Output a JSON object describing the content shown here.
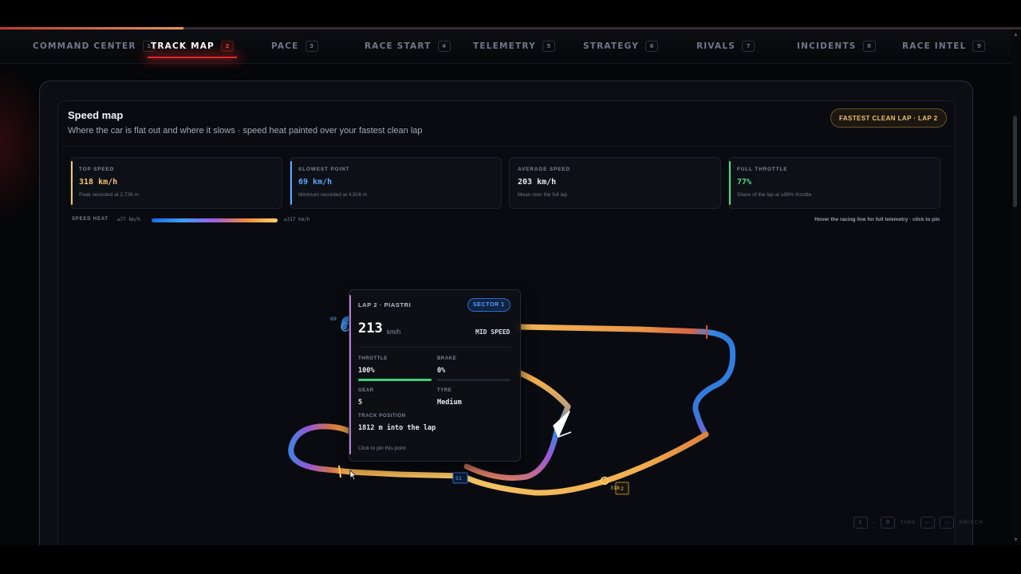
{
  "header": {
    "progress_fraction": 0.18,
    "tabs": [
      {
        "label": "COMMAND CENTER",
        "num": "1"
      },
      {
        "label": "TRACK MAP",
        "num": "2"
      },
      {
        "label": "PACE",
        "num": "3"
      },
      {
        "label": "RACE START",
        "num": "4"
      },
      {
        "label": "TELEMETRY",
        "num": "5"
      },
      {
        "label": "STRATEGY",
        "num": "6"
      },
      {
        "label": "RIVALS",
        "num": "7"
      },
      {
        "label": "INCIDENTS",
        "num": "8"
      },
      {
        "label": "RACE INTEL",
        "num": "9"
      }
    ],
    "active_tab": "TRACK MAP"
  },
  "card": {
    "title": "Speed map",
    "subtitle": "Where the car is flat out and where it slows · speed heat painted over your fastest clean lap",
    "lap_pill": "FASTEST CLEAN LAP · LAP 2"
  },
  "stats": [
    {
      "label": "TOP SPEED",
      "value": "318 km/h",
      "note": "Peak recorded at 2,738 m",
      "color": "#f3c76b"
    },
    {
      "label": "SLOWEST POINT",
      "value": "69 km/h",
      "note": "Minimum recorded at 4,926 m",
      "color": "#5aa8ff"
    },
    {
      "label": "AVERAGE SPEED",
      "value": "203 km/h",
      "note": "Mean over the full lap",
      "color": "#e8eaef"
    },
    {
      "label": "FULL THROTTLE",
      "value": "77%",
      "note": "Share of the lap at ≥98% throttle",
      "color": "#4fdc8a"
    }
  ],
  "heat": {
    "label": "SPEED HEAT",
    "min": "≤77 km/h",
    "max": "≥317 km/h",
    "hint": "Hover the racing line for full telemetry · click to pin"
  },
  "map_labels": {
    "slow_marker": "69",
    "fast_marker": "318",
    "sector_tag": "S1",
    "turn_tag": "2"
  },
  "tooltip": {
    "lap": "LAP 2 · PIASTRI",
    "sector": "SECTOR 1",
    "speed": "213",
    "unit": "km/h",
    "band": "MID SPEED",
    "throttle_label": "THROTTLE",
    "throttle": "100%",
    "throttle_fraction": 1.0,
    "brake_label": "BRAKE",
    "brake": "0%",
    "brake_fraction": 0.0,
    "gear_label": "GEAR",
    "gear": "5",
    "tyre_label": "TYRE",
    "tyre": "Medium",
    "position_label": "TRACK POSITION",
    "position": "1812 m into the lap",
    "click_hint": "Click to pin this point"
  },
  "footer": {
    "first_tab": "1",
    "separator": "–",
    "last_tab": "9",
    "tabs_label": "TABS",
    "prev_key": "←",
    "next_key": "→",
    "switch_label": "SWITCH"
  },
  "colors": {
    "accent": "#e02a2a",
    "gold": "#f0c36d",
    "sector": "#5aa0ff"
  }
}
